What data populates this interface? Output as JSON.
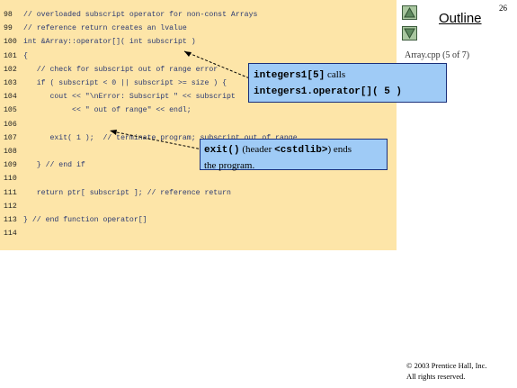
{
  "page_number": "26",
  "outline": {
    "title": "Outline",
    "up_icon": "triangle-up-icon",
    "down_icon": "triangle-down-icon"
  },
  "slide_label": "Array.cpp (5 of 7)",
  "code_lines": [
    {
      "num": "98",
      "text": "// overloaded subscript operator for non-const Arrays"
    },
    {
      "num": "99",
      "text": "// reference return creates an lvalue"
    },
    {
      "num": "100",
      "text": "int &Array::operator[]( int subscript )"
    },
    {
      "num": "101",
      "text": "{"
    },
    {
      "num": "102",
      "text": "   // check for subscript out of range error"
    },
    {
      "num": "103",
      "text": "   if ( subscript < 0 || subscript >= size ) {"
    },
    {
      "num": "104",
      "text": "      cout << \"\\nError: Subscript \" << subscript"
    },
    {
      "num": "105",
      "text": "           << \" out of range\" << endl;"
    },
    {
      "num": "106",
      "text": ""
    },
    {
      "num": "107",
      "text": "      exit( 1 );  // terminate program; subscript out of range"
    },
    {
      "num": "108",
      "text": ""
    },
    {
      "num": "109",
      "text": "   } // end if"
    },
    {
      "num": "110",
      "text": ""
    },
    {
      "num": "111",
      "text": "   return ptr[ subscript ]; // reference return"
    },
    {
      "num": "112",
      "text": ""
    },
    {
      "num": "113",
      "text": "} // end function operator[]"
    },
    {
      "num": "114",
      "text": ""
    }
  ],
  "callout_1": {
    "line1_code": "integers1[5]",
    "line1_text": " calls",
    "line2_code": "integers1.operator[]( 5 )"
  },
  "callout_2": {
    "code": "exit()",
    "text_a": " (header ",
    "code_b": "<cstdlib>",
    "text_b": ") ends",
    "line2": "the program."
  },
  "copyright": {
    "line1": "© 2003 Prentice Hall, Inc.",
    "line2": "All rights reserved."
  }
}
